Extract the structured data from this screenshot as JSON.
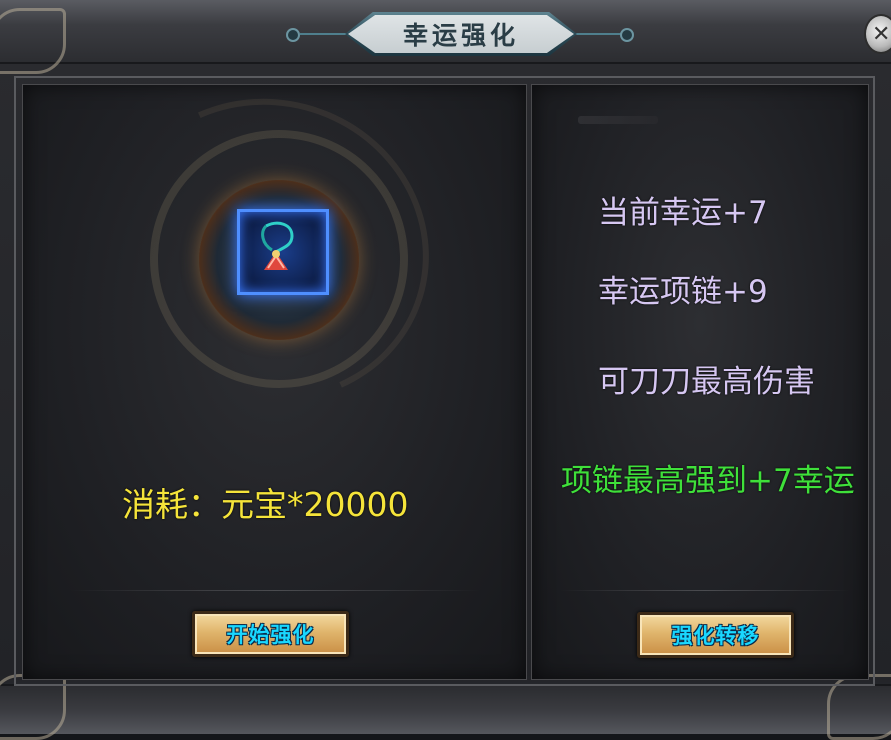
{
  "window": {
    "title": "幸运强化",
    "close_symbol": "✕"
  },
  "item": {
    "name": "necklace-icon"
  },
  "cost": {
    "text": "消耗：元宝*20000"
  },
  "info": {
    "current_luck": "当前幸运+7",
    "necklace_luck": "幸运项链+9",
    "max_damage": "可刀刀最高伤害",
    "max_strengthen": "项链最高强到+7幸运"
  },
  "buttons": {
    "start_label": "开始强化",
    "transfer_label": "强化转移"
  },
  "colors": {
    "cost": "#f5e43a",
    "info": "#d6c7f2",
    "highlight": "#3fe03a",
    "button_text": "#19d8ff",
    "slot_glow": "#4f8fff"
  }
}
